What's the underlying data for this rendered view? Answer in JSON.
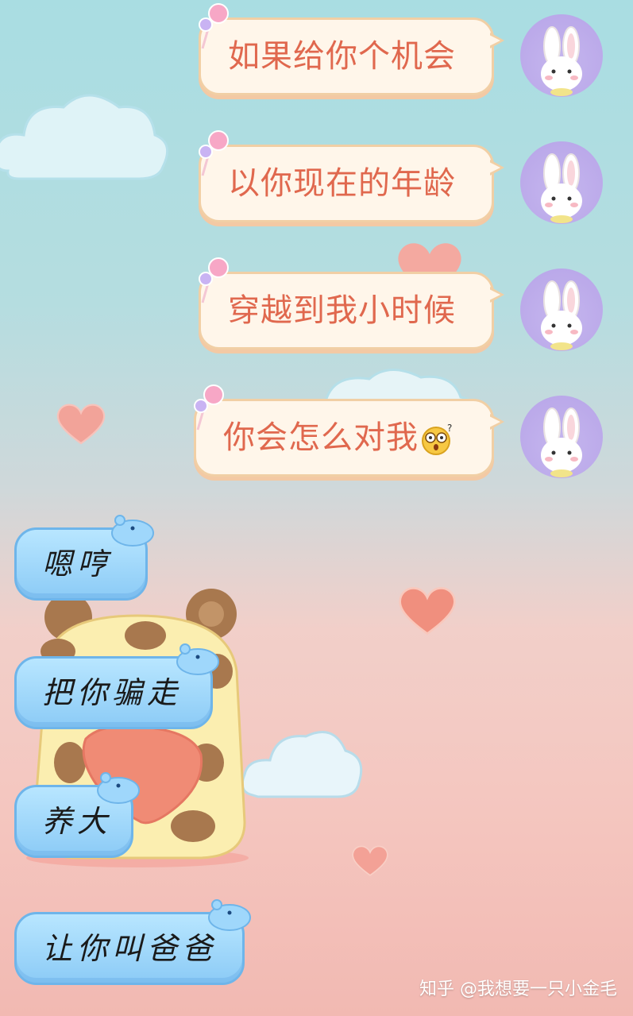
{
  "chat": {
    "outgoing": [
      {
        "text": "如果给你个机会"
      },
      {
        "text": "以你现在的年龄"
      },
      {
        "text": "穿越到我小时候"
      },
      {
        "text": "你会怎么对我"
      }
    ],
    "incoming": [
      {
        "text": "嗯哼"
      },
      {
        "text": "把你骗走"
      },
      {
        "text": "养大"
      },
      {
        "text": "让你叫爸爸"
      }
    ]
  },
  "watermark": {
    "text": "知乎 @我想要一只小金毛"
  },
  "icons": {
    "avatar": "bunny-avatar-icon",
    "bubble_deco": "lollipop-icon",
    "incoming_deco": "hippo-icon",
    "emoji": "shocked-face-emoji"
  },
  "colors": {
    "outgoing_text": "#e0684e",
    "outgoing_bubble": "#fff6ea",
    "incoming_bubble": "#8ccbf6",
    "avatar_bg": "#b7a4e8"
  }
}
